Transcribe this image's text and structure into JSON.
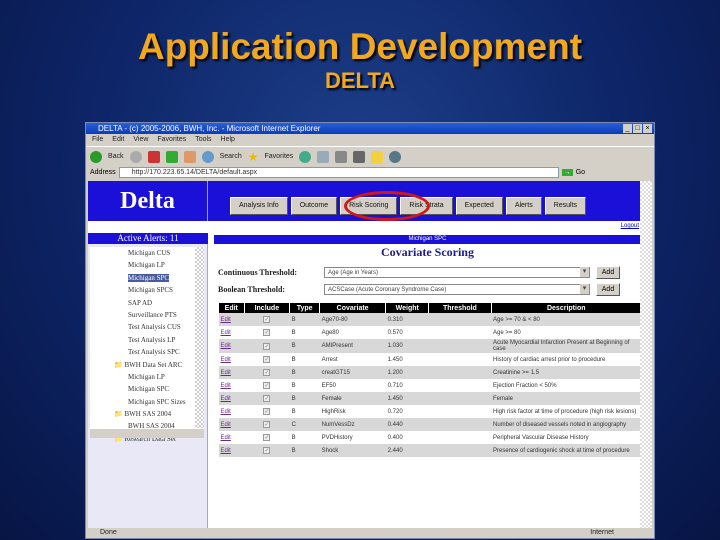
{
  "slide": {
    "title": "Application Development",
    "subtitle": "DELTA"
  },
  "browser": {
    "title": "DELTA - (c) 2005-2006, BWH, Inc. - Microsoft Internet Explorer",
    "menu": [
      "File",
      "Edit",
      "View",
      "Favorites",
      "Tools",
      "Help"
    ],
    "toolbar": {
      "back": "Back",
      "search": "Search",
      "favorites": "Favorites"
    },
    "address_label": "Address",
    "address": "http://170.223.65.14/DELTA/default.aspx",
    "go": "Go",
    "status": "Done",
    "zone": "Internet"
  },
  "app": {
    "logo": "Delta",
    "tabs": [
      "Analysis Info",
      "Outcome",
      "Risk Scoring",
      "Risk Strata",
      "Expected",
      "Alerts",
      "Results"
    ],
    "logout": "Logout",
    "active_alerts": "Active Alerts: 11",
    "analysis": "Michigan SPC",
    "section_title": "Covariate Scoring",
    "tree": [
      {
        "label": "Michigan CUS"
      },
      {
        "label": "Michigan LP"
      },
      {
        "label": "Michigan SPC",
        "selected": true
      },
      {
        "label": "Michigan SPCS"
      },
      {
        "label": "SAP AD"
      },
      {
        "label": "Surveillance PTS"
      },
      {
        "label": "Test Analysis CUS"
      },
      {
        "label": "Test Analysis LP"
      },
      {
        "label": "Test Analysis SPC"
      },
      {
        "label": "BWH Data Set ARC",
        "folder": true
      },
      {
        "label": "Michigan LP"
      },
      {
        "label": "Michigan SPC"
      },
      {
        "label": "Michigan SPC Sizes"
      },
      {
        "label": "BWH SAS 2004",
        "folder": true
      },
      {
        "label": "BWH SAS 2004"
      },
      {
        "label": "Research Data Set",
        "folder": true
      }
    ],
    "continuous": {
      "label": "Continuous Threshold:",
      "value": "Age (Age in Years)",
      "add": "Add"
    },
    "boolean": {
      "label": "Boolean Threshold:",
      "value": "ACSCase (Acute Coronary Syndrome Case)",
      "add": "Add"
    },
    "columns": [
      "Edit",
      "Include",
      "Type",
      "Covariate",
      "Weight",
      "Threshold",
      "Description"
    ],
    "rows": [
      {
        "edit": "Edit",
        "type": "B",
        "covariate": "Age70-80",
        "weight": "0.310",
        "description": "Age >= 70 & < 80"
      },
      {
        "edit": "Edit",
        "type": "B",
        "covariate": "Age80",
        "weight": "0.570",
        "description": "Age >= 80"
      },
      {
        "edit": "Edit",
        "type": "B",
        "covariate": "AMIPresent",
        "weight": "1.030",
        "description": "Acute Myocardial Infarction Present at Beginning of case"
      },
      {
        "edit": "Edit",
        "type": "B",
        "covariate": "Arrest",
        "weight": "1.450",
        "description": "History of cardiac arrest prior to procedure"
      },
      {
        "edit": "Edit",
        "type": "B",
        "covariate": "creatGT15",
        "weight": "1.200",
        "description": "Creatinine >= 1.5"
      },
      {
        "edit": "Edit",
        "type": "B",
        "covariate": "EF50",
        "weight": "0.710",
        "description": "Ejection Fraction < 50%"
      },
      {
        "edit": "Edit",
        "type": "B",
        "covariate": "Female",
        "weight": "1.450",
        "description": "Female"
      },
      {
        "edit": "Edit",
        "type": "B",
        "covariate": "HighRisk",
        "weight": "0.720",
        "description": "High risk factor at time of procedure (high risk lesions)"
      },
      {
        "edit": "Edit",
        "type": "C",
        "covariate": "NumVessDz",
        "weight": "0.440",
        "description": "Number of diseased vessels noted in angiography"
      },
      {
        "edit": "Edit",
        "type": "B",
        "covariate": "PVDHistory",
        "weight": "0.400",
        "description": "Peripheral Vascular Disease History"
      },
      {
        "edit": "Edit",
        "type": "B",
        "covariate": "Shock",
        "weight": "2.440",
        "description": "Presence of cardiogenic shock at time of procedure"
      }
    ]
  }
}
